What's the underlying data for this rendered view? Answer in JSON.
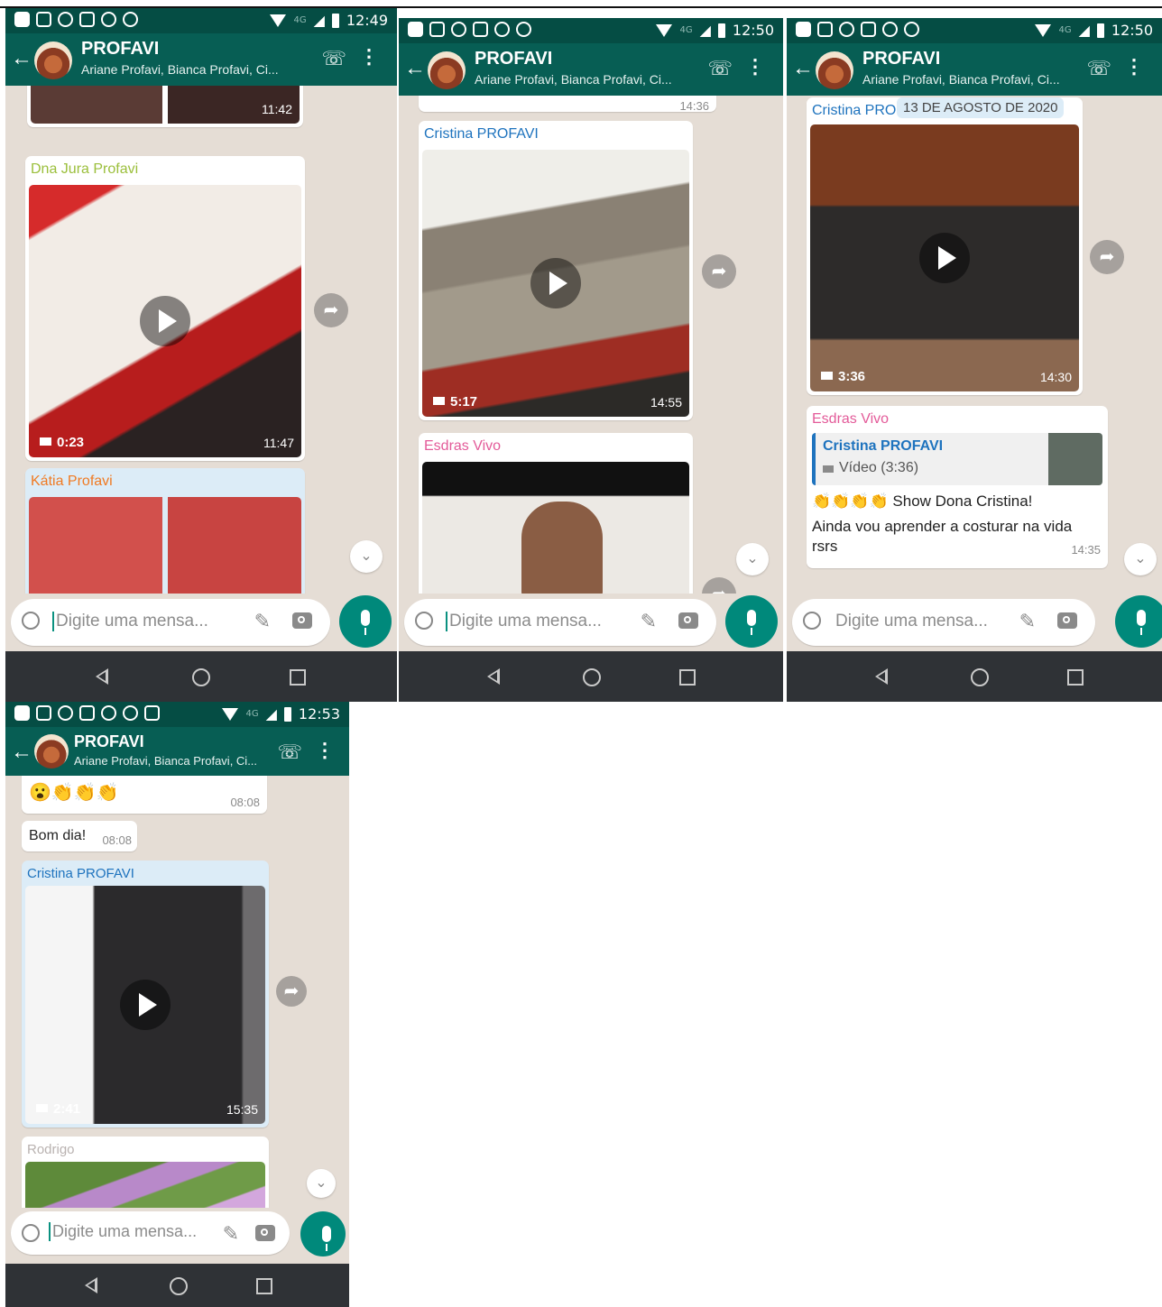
{
  "panels": [
    {
      "status_time": "12:49",
      "header": {
        "title": "PROFAVI",
        "subtitle": "Ariane Profavi, Bianca Profavi, Ci..."
      },
      "messages": [
        {
          "time": "11:42"
        },
        {
          "sender": "Dna Jura Profavi",
          "duration": "0:23",
          "time": "11:47"
        },
        {
          "sender": "Kátia Profavi"
        }
      ],
      "input_placeholder": "Digite uma mensa..."
    },
    {
      "status_time": "12:50",
      "header": {
        "title": "PROFAVI",
        "subtitle": "Ariane Profavi, Bianca Profavi, Ci..."
      },
      "messages": [
        {
          "time": "14:36"
        },
        {
          "sender": "Cristina PROFAVI",
          "duration": "5:17",
          "time": "14:55"
        },
        {
          "sender": "Esdras Vivo"
        }
      ],
      "input_placeholder": "Digite uma mensa..."
    },
    {
      "status_time": "12:50",
      "header": {
        "title": "PROFAVI",
        "subtitle": "Ariane Profavi, Bianca Profavi, Ci..."
      },
      "date_chip": "13 DE AGOSTO DE 2020",
      "messages": [
        {
          "sender": "Cristina PRO",
          "duration": "3:36",
          "time": "14:30"
        },
        {
          "sender": "Esdras Vivo",
          "quote_sender": "Cristina PROFAVI",
          "quote_text": "Vídeo (3:36)",
          "emoji": "👏👏👏👏",
          "text_line1": "Show Dona Cristina!",
          "text_line2": "Ainda vou aprender a costurar na vida",
          "text_line3": "rsrs",
          "time": "14:35"
        }
      ],
      "input_placeholder": "Digite uma mensa..."
    },
    {
      "status_time": "12:53",
      "header": {
        "title": "PROFAVI",
        "subtitle": "Ariane Profavi, Bianca Profavi, Ci..."
      },
      "messages": [
        {
          "emoji": "😮👏👏👏",
          "time": "08:08"
        },
        {
          "text": "Bom dia!",
          "time": "08:08"
        },
        {
          "sender": "Cristina PROFAVI",
          "duration": "2:41",
          "time": "15:35"
        },
        {
          "sender": "Rodrigo"
        }
      ],
      "input_placeholder": "Digite uma mensa..."
    }
  ],
  "colors": {
    "status_bar": "#054d44",
    "app_bar": "#075e54",
    "chat_bg": "#e5ddd5",
    "mic_button": "#00897b",
    "sender_green": "#9bbf3b",
    "sender_orange": "#f07a22",
    "sender_blue": "#1e73be",
    "sender_pink": "#e35b99"
  }
}
